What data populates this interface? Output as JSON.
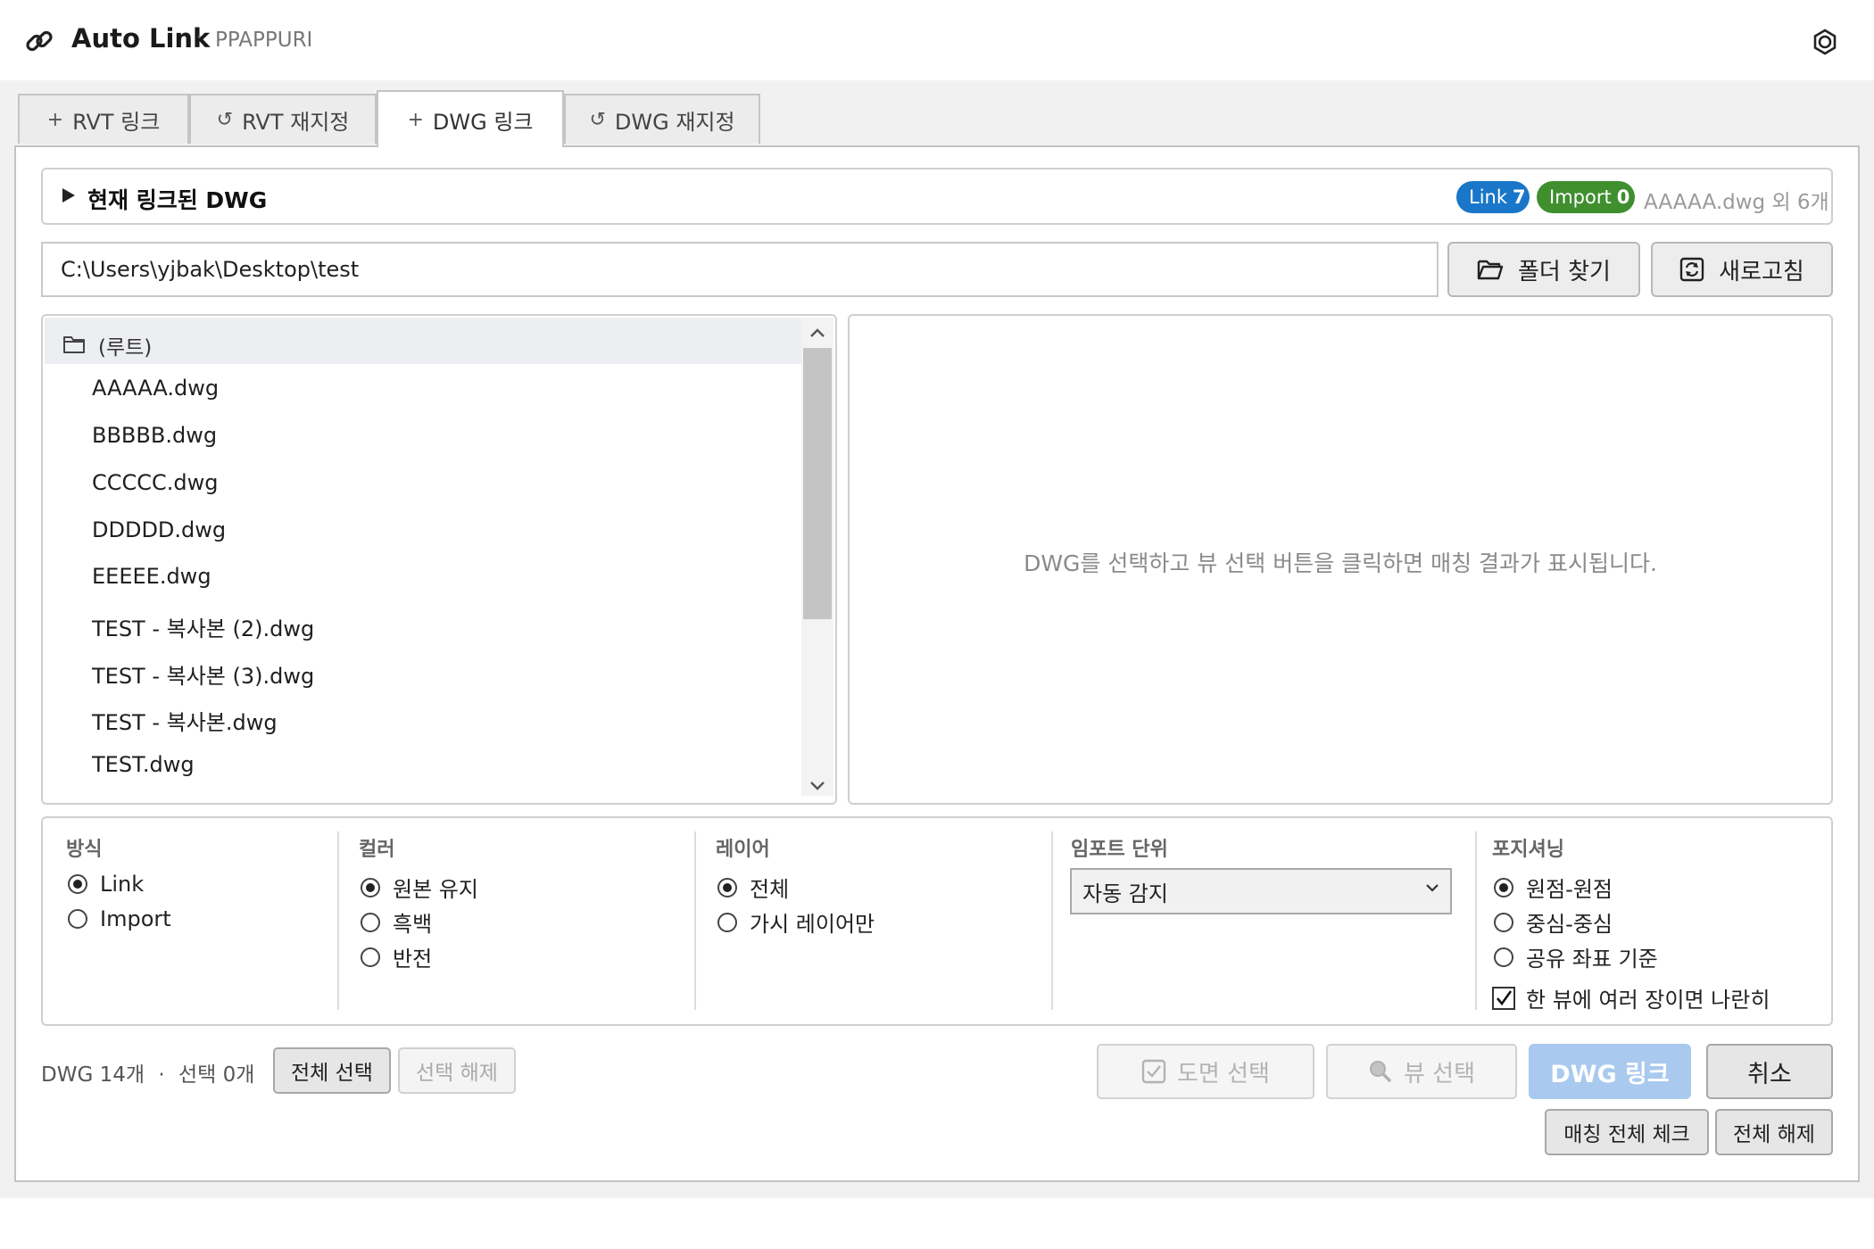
{
  "app": {
    "title": "Auto Link",
    "separator": "·",
    "subtitle": "PPAPPURI"
  },
  "tabs": [
    {
      "glyph": "+",
      "label": "RVT 링크"
    },
    {
      "glyph": "↺",
      "label": "RVT 재지정"
    },
    {
      "glyph": "+",
      "label": "DWG 링크",
      "active": true
    },
    {
      "glyph": "↺",
      "label": "DWG 재지정"
    }
  ],
  "linked": {
    "title": "현재 링크된 DWG",
    "link_badge_label": "Link",
    "link_badge_count": "7",
    "import_badge_label": "Import",
    "import_badge_count": "0",
    "summary": "AAAAA.dwg 외 6개"
  },
  "path": {
    "value": "C:\\Users\\yjbak\\Desktop\\test"
  },
  "buttons": {
    "browse": "폴더 찾기",
    "refresh": "새로고침"
  },
  "tree": {
    "root": "(루트)",
    "files": [
      "AAAAA.dwg",
      "BBBBB.dwg",
      "CCCCC.dwg",
      "DDDDD.dwg",
      "EEEEE.dwg",
      "TEST - 복사본 (2).dwg",
      "TEST - 복사본 (3).dwg",
      "TEST - 복사본.dwg",
      "TEST.dwg"
    ]
  },
  "preview": {
    "message": "DWG를 선택하고 뷰 선택 버튼을 클릭하면 매칭 결과가 표시됩니다."
  },
  "options": {
    "method": {
      "title": "방식",
      "options": [
        "Link",
        "Import"
      ]
    },
    "color": {
      "title": "컬러",
      "options": [
        "원본 유지",
        "흑백",
        "반전"
      ]
    },
    "layer": {
      "title": "레이어",
      "options": [
        "전체",
        "가시 레이어만"
      ]
    },
    "unit": {
      "title": "임포트 단위",
      "value": "자동 감지"
    },
    "positioning": {
      "title": "포지셔닝",
      "options": [
        "원점-원점",
        "중심-중심",
        "공유 좌표 기준"
      ],
      "side_by_side": "한 뷰에 여러 장이면 나란히"
    }
  },
  "footer": {
    "dwg_count": "DWG 14개",
    "dot": "·",
    "selected_count": "선택 0개",
    "select_all": "전체 선택",
    "deselect": "선택 해제",
    "sheet_select": "도면 선택",
    "view_select": "뷰 선택",
    "dwg_link": "DWG 링크",
    "cancel": "취소",
    "check_all_matches": "매칭 전체 체크",
    "clear_all": "전체 해제"
  },
  "colors": {
    "link_badge": "#1976c8",
    "import_badge": "#3f8f2f",
    "primary_disabled": "#a9c9ef"
  }
}
